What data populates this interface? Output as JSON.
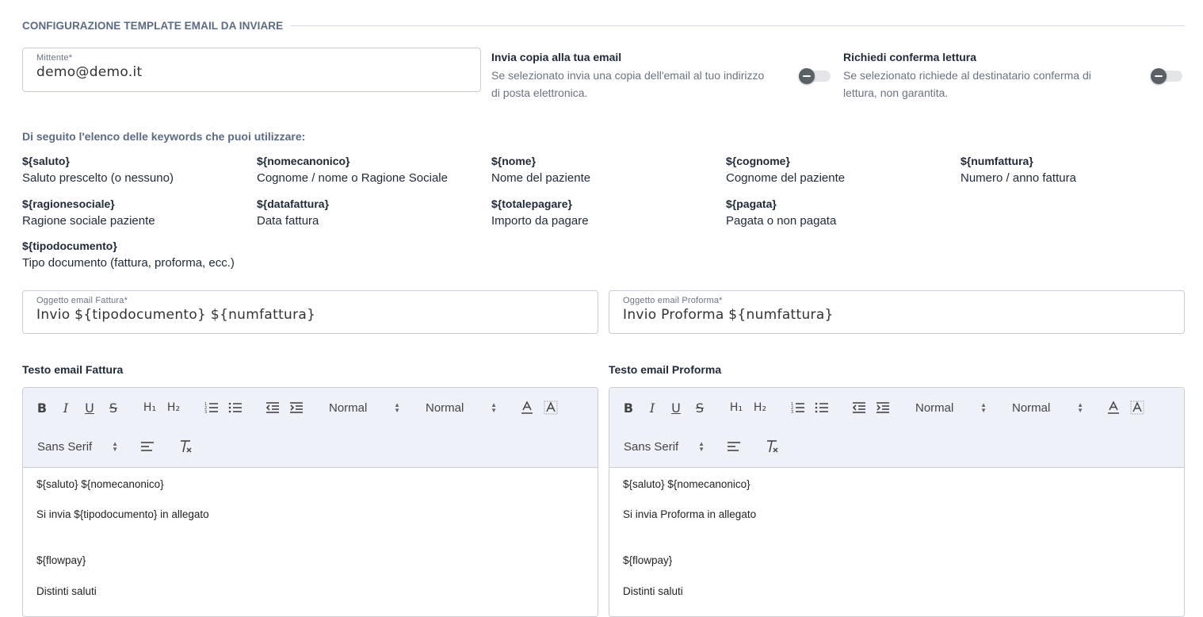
{
  "section": {
    "title": "CONFIGURAZIONE TEMPLATE EMAIL DA INVIARE"
  },
  "sender": {
    "label": "Mittente*",
    "value": "demo@demo.it"
  },
  "copy_option": {
    "title": "Invia copia alla tua email",
    "description_line1": "Se selezionato invia una copia dell'email al tuo indirizzo",
    "description_line2": "di posta elettronica.",
    "enabled": false
  },
  "read_receipt": {
    "title": "Richiedi conferma lettura",
    "description_line1": "Se selezionato richiede al destinatario conferma di",
    "description_line2": "lettura, non garantita.",
    "enabled": false
  },
  "keywords": {
    "intro": "Di seguito l'elenco delle keywords che puoi utilizzare:",
    "items": [
      {
        "name": "${saluto}",
        "desc": "Saluto prescelto (o nessuno)"
      },
      {
        "name": "${nomecanonico}",
        "desc": "Cognome / nome o Ragione Sociale"
      },
      {
        "name": "${nome}",
        "desc": "Nome del paziente"
      },
      {
        "name": "${cognome}",
        "desc": "Cognome del paziente"
      },
      {
        "name": "${numfattura}",
        "desc": "Numero / anno fattura"
      },
      {
        "name": "${ragionesociale}",
        "desc": "Ragione sociale paziente"
      },
      {
        "name": "${datafattura}",
        "desc": "Data fattura"
      },
      {
        "name": "${totalepagare}",
        "desc": "Importo da pagare"
      },
      {
        "name": "${pagata}",
        "desc": "Pagata o non pagata"
      },
      {
        "name": "${tipodocumento}",
        "desc": "Tipo documento (fattura, proforma, ecc.)"
      }
    ]
  },
  "subject_invoice": {
    "label": "Oggetto email Fattura*",
    "value": "Invio ${tipodocumento} ${numfattura}"
  },
  "subject_proforma": {
    "label": "Oggetto email Proforma*",
    "value": "Invio Proforma ${numfattura}"
  },
  "editor_invoice": {
    "label": "Testo email Fattura",
    "toolbar": {
      "header_select": "Normal",
      "size_select": "Normal",
      "font_select": "Sans Serif"
    },
    "lines": [
      "${saluto} ${nomecanonico}",
      "Si invia ${tipodocumento} in allegato",
      "${flowpay}",
      "Distinti saluti"
    ]
  },
  "editor_proforma": {
    "label": "Testo email Proforma",
    "toolbar": {
      "header_select": "Normal",
      "size_select": "Normal",
      "font_select": "Sans Serif"
    },
    "lines": [
      "${saluto} ${nomecanonico}",
      "Si invia Proforma in allegato",
      "${flowpay}",
      "Distinti saluti"
    ]
  },
  "colors": {
    "accent_text": "#5b6b84",
    "toolbar_bg": "#eef2f8",
    "border": "#c9ced6",
    "toggle_knob": "#5a6068"
  }
}
